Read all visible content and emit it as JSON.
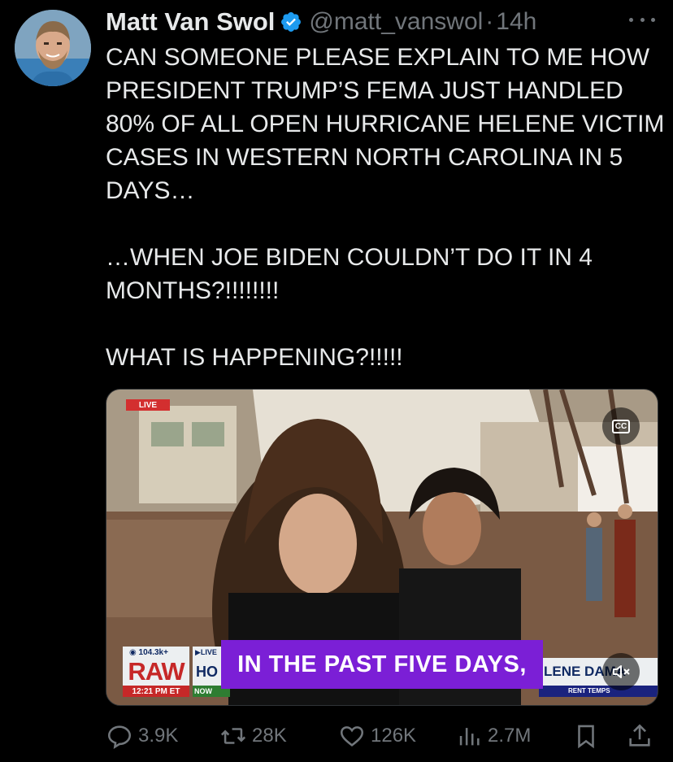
{
  "author": {
    "name": "Matt Van Swol",
    "handle": "@matt_vanswol",
    "separator": "·",
    "time": "14h",
    "verified": true
  },
  "tweet": {
    "text": "CAN SOMEONE PLEASE EXPLAIN TO ME HOW PRESIDENT TRUMP’S FEMA JUST HANDLED 80% OF ALL OPEN HURRICANE HELENE VICTIM CASES IN WESTERN NORTH CAROLINA IN 5 DAYS…\n\n…WHEN JOE BIDEN COULDN’T DO IT IN 4 MONTHS?!!!!!!!!\n\nWHAT IS HAPPENING?!!!!!"
  },
  "video": {
    "live_tag": "LIVE",
    "cc_label": "CC",
    "views_badge": "104.3k+",
    "live_badge": "LIVE",
    "network": "RAW",
    "clock": "12:21 PM ET",
    "headline_fragment": "HO",
    "now_label": "NOW",
    "caption": "IN THE PAST FIVE DAYS,",
    "ticker_right": "LENE DAMA",
    "ticker_right_sub": "RENT TEMPS"
  },
  "actions": {
    "replies": "3.9K",
    "reposts": "28K",
    "likes": "126K",
    "views": "2.7M"
  },
  "colors": {
    "accent": "#1d9bf0",
    "muted": "#71767b",
    "caption_bg": "#7b1fd6",
    "raw_red": "#c62828"
  }
}
